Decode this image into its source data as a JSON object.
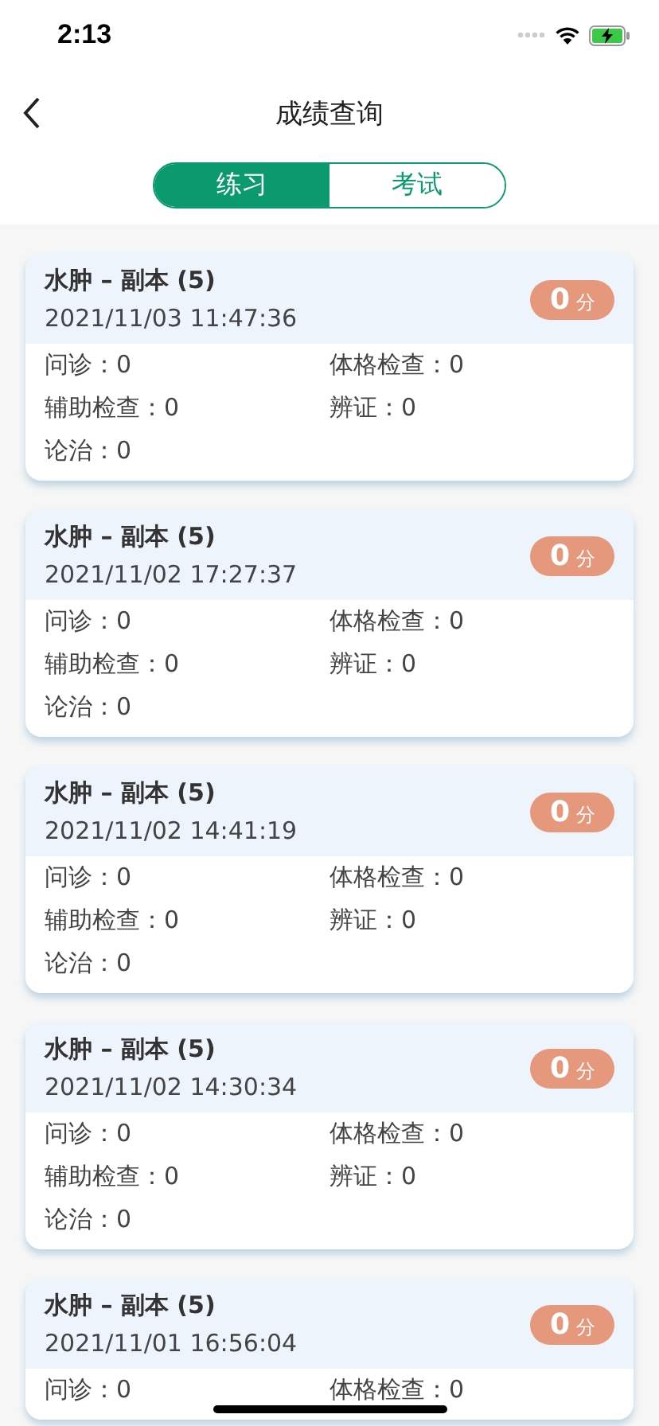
{
  "status_bar": {
    "time": "2:13"
  },
  "nav": {
    "title": "成绩查询"
  },
  "tabs": [
    {
      "label": "练习",
      "selected": true
    },
    {
      "label": "考试",
      "selected": false
    }
  ],
  "records": [
    {
      "title": "水肿 – 副本 (5)",
      "date": "2021/11/03 11:47:36",
      "score": {
        "value": "0",
        "unit": "分"
      },
      "items": [
        "问诊：0",
        "体格检查：0",
        "辅助检查：0",
        "辨证：0",
        "论治：0"
      ]
    },
    {
      "title": "水肿 – 副本 (5)",
      "date": "2021/11/02 17:27:37",
      "score": {
        "value": "0",
        "unit": "分"
      },
      "items": [
        "问诊：0",
        "体格检查：0",
        "辅助检查：0",
        "辨证：0",
        "论治：0"
      ]
    },
    {
      "title": "水肿 – 副本 (5)",
      "date": "2021/11/02 14:41:19",
      "score": {
        "value": "0",
        "unit": "分"
      },
      "items": [
        "问诊：0",
        "体格检查：0",
        "辅助检查：0",
        "辨证：0",
        "论治：0"
      ]
    },
    {
      "title": "水肿 – 副本 (5)",
      "date": "2021/11/02 14:30:34",
      "score": {
        "value": "0",
        "unit": "分"
      },
      "items": [
        "问诊：0",
        "体格检查：0",
        "辅助检查：0",
        "辨证：0",
        "论治：0"
      ]
    },
    {
      "title": "水肿 – 副本 (5)",
      "date": "2021/11/01 16:56:04",
      "score": {
        "value": "0",
        "unit": "分"
      },
      "items": [
        "问诊：0",
        "体格检查：0"
      ]
    }
  ]
}
